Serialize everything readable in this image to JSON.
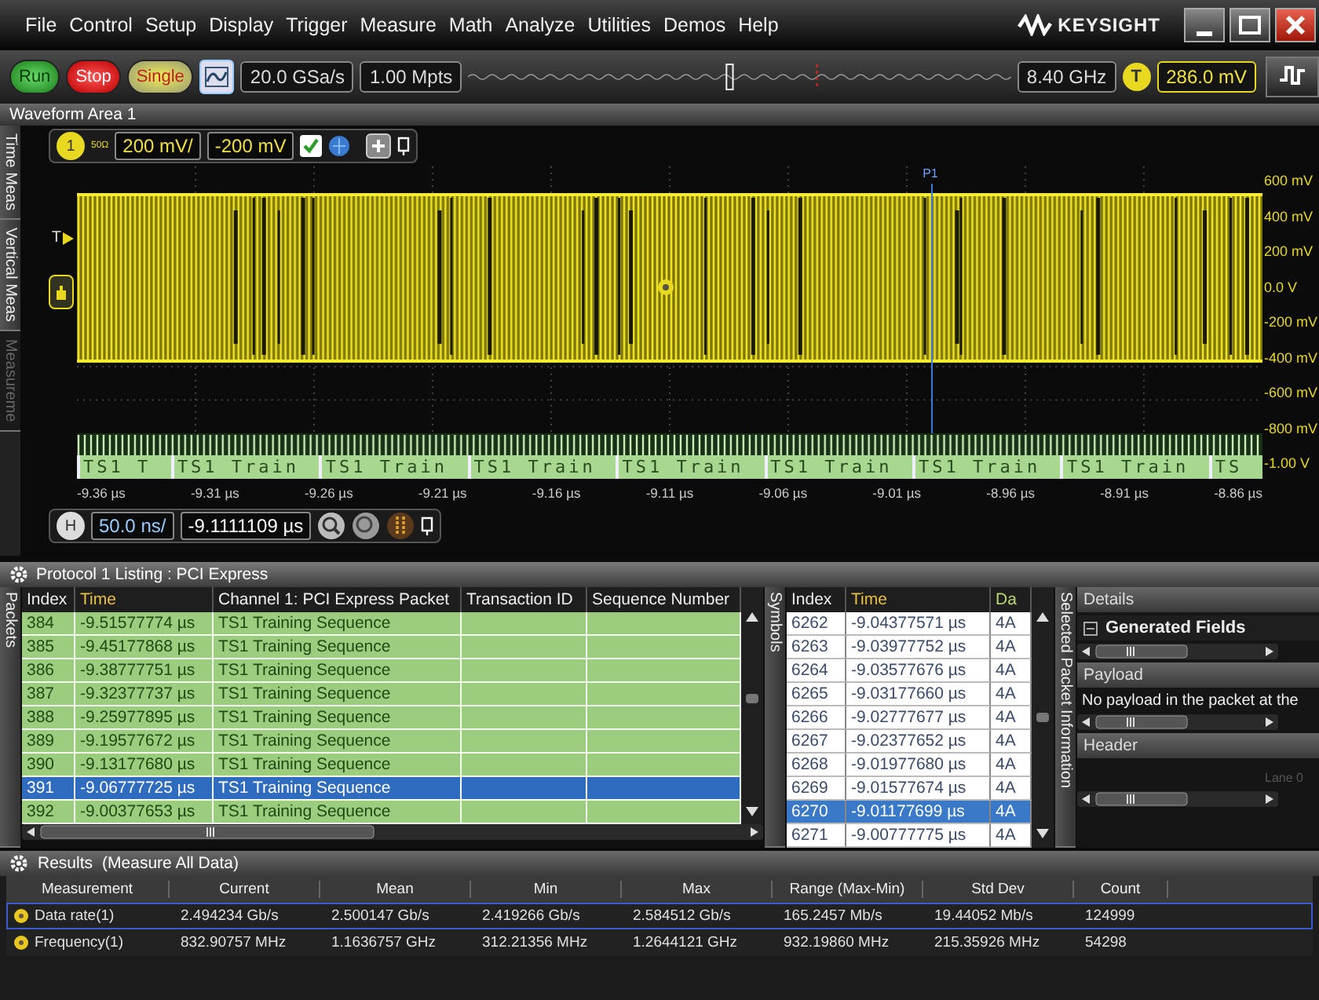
{
  "menu_bar": {
    "items": [
      "File",
      "Control",
      "Setup",
      "Display",
      "Trigger",
      "Measure",
      "Math",
      "Analyze",
      "Utilities",
      "Demos",
      "Help"
    ],
    "logo_text": "KEYSIGHT"
  },
  "toolbar": {
    "buttons": [
      {
        "label": "Run",
        "kind": "run"
      },
      {
        "label": "Stop",
        "kind": "stop"
      },
      {
        "label": "Single",
        "kind": "single"
      }
    ],
    "sample_rate": "20.0 GSa/s",
    "memory_depth": "1.00 Mpts",
    "bandwidth": "8.40 GHz",
    "trigger_badge": "T",
    "trigger_level": "286.0 mV"
  },
  "waveform_area": {
    "title": "Waveform Area 1",
    "side_tabs": [
      {
        "label": "Time Meas",
        "disabled": false
      },
      {
        "label": "Vertical Meas",
        "disabled": false
      },
      {
        "label": "Measureme",
        "disabled": true
      }
    ],
    "channel": {
      "badge": "1",
      "impedance": "50Ω",
      "scale": "200 mV/",
      "offset": "-200 mV",
      "display_on": true
    },
    "trigger_marker": "T",
    "cursor_label": "P1",
    "y_labels": [
      "600 mV",
      "400 mV",
      "200 mV",
      "0.0 V",
      "-200 mV",
      "-400 mV",
      "-600 mV",
      "-800 mV",
      "-1.00 V"
    ],
    "x_labels": [
      "-9.36 µs",
      "-9.31 µs",
      "-9.26 µs",
      "-9.21 µs",
      "-9.16 µs",
      "-9.11 µs",
      "-9.06 µs",
      "-9.01 µs",
      "-8.96 µs",
      "-8.91 µs",
      "-8.86 µs"
    ],
    "bus_segments": [
      "TS1 T",
      "TS1 Train",
      "TS1 Train",
      "TS1 Train",
      "TS1 Train",
      "TS1 Train",
      "TS1 Train",
      "TS1 Train",
      "TS"
    ],
    "timebase": {
      "badge": "H",
      "scale": "50.0 ns/",
      "position": "-9.1111109 µs"
    }
  },
  "protocol_listing": {
    "title": "Protocol 1 Listing : PCI Express",
    "side_tab": "Packets",
    "columns": [
      "Index",
      "Time",
      "Channel 1: PCI Express Packet",
      "Transaction ID",
      "Sequence Number"
    ],
    "rows": [
      {
        "index": "384",
        "time": "-9.51577774 µs",
        "packet": "TS1 Training Sequence",
        "selected": false
      },
      {
        "index": "385",
        "time": "-9.45177868 µs",
        "packet": "TS1 Training Sequence",
        "selected": false
      },
      {
        "index": "386",
        "time": "-9.38777751 µs",
        "packet": "TS1 Training Sequence",
        "selected": false
      },
      {
        "index": "387",
        "time": "-9.32377737 µs",
        "packet": "TS1 Training Sequence",
        "selected": false
      },
      {
        "index": "388",
        "time": "-9.25977895 µs",
        "packet": "TS1 Training Sequence",
        "selected": false
      },
      {
        "index": "389",
        "time": "-9.19577672 µs",
        "packet": "TS1 Training Sequence",
        "selected": false
      },
      {
        "index": "390",
        "time": "-9.13177680 µs",
        "packet": "TS1 Training Sequence",
        "selected": false
      },
      {
        "index": "391",
        "time": "-9.06777725 µs",
        "packet": "TS1 Training Sequence",
        "selected": true
      },
      {
        "index": "392",
        "time": "-9.00377653 µs",
        "packet": "TS1 Training Sequence",
        "selected": false
      }
    ]
  },
  "symbols": {
    "side_tab": "Symbols",
    "columns": [
      "Index",
      "Time",
      "Da"
    ],
    "rows": [
      {
        "index": "6262",
        "time": "-9.04377571 µs",
        "data": "4A",
        "selected": false
      },
      {
        "index": "6263",
        "time": "-9.03977752 µs",
        "data": "4A",
        "selected": false
      },
      {
        "index": "6264",
        "time": "-9.03577676 µs",
        "data": "4A",
        "selected": false
      },
      {
        "index": "6265",
        "time": "-9.03177660 µs",
        "data": "4A",
        "selected": false
      },
      {
        "index": "6266",
        "time": "-9.02777677 µs",
        "data": "4A",
        "selected": false
      },
      {
        "index": "6267",
        "time": "-9.02377652 µs",
        "data": "4A",
        "selected": false
      },
      {
        "index": "6268",
        "time": "-9.01977680 µs",
        "data": "4A",
        "selected": false
      },
      {
        "index": "6269",
        "time": "-9.01577674 µs",
        "data": "4A",
        "selected": false
      },
      {
        "index": "6270",
        "time": "-9.01177699 µs",
        "data": "4A",
        "selected": true
      },
      {
        "index": "6271",
        "time": "-9.00777775 µs",
        "data": "4A",
        "selected": false
      }
    ]
  },
  "packet_details": {
    "side_tab": "Selected Packet Information",
    "details_title": "Details",
    "generated_fields": "Generated Fields",
    "payload_title": "Payload",
    "payload_text": "No payload in the packet at the",
    "header_title": "Header",
    "lane_label": "Lane 0"
  },
  "results": {
    "title": "Results",
    "subtitle": "(Measure All Data)",
    "columns": [
      "Measurement",
      "Current",
      "Mean",
      "Min",
      "Max",
      "Range (Max-Min)",
      "Std Dev",
      "Count"
    ],
    "rows": [
      {
        "measurement": "Data rate(1)",
        "values": [
          "2.494234 Gb/s",
          "2.500147 Gb/s",
          "2.419266 Gb/s",
          "2.584512 Gb/s",
          "165.2457 Mb/s",
          "19.44052 Mb/s",
          "124999"
        ],
        "selected": true
      },
      {
        "measurement": "Frequency(1)",
        "values": [
          "832.90757 MHz",
          "1.1636757 GHz",
          "312.21356 MHz",
          "1.2644121 GHz",
          "932.19860 MHz",
          "215.35926 MHz",
          "54298"
        ],
        "selected": false
      }
    ]
  }
}
